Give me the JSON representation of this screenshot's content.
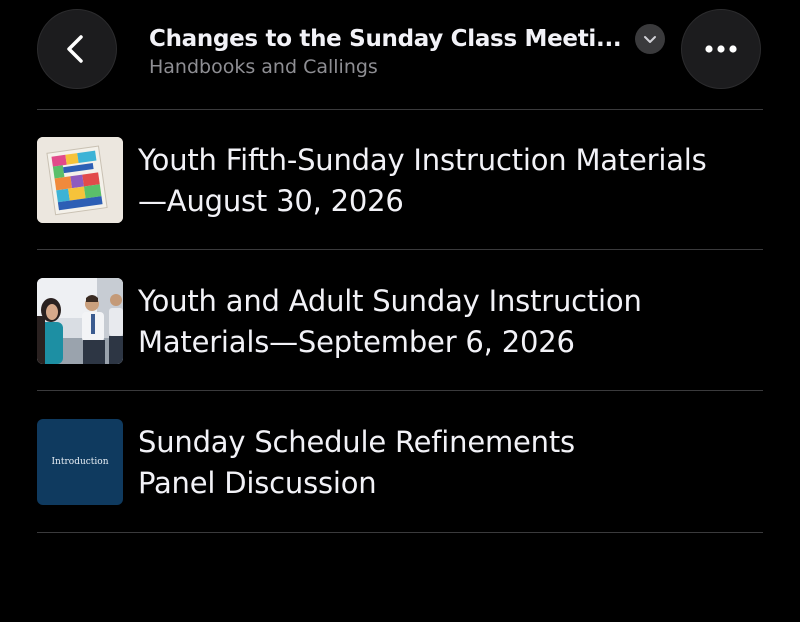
{
  "header": {
    "title": "Changes to the Sunday Class Meeti...",
    "subtitle": "Handbooks and Callings",
    "back_icon": "chevron-left-icon",
    "dropdown_icon": "chevron-down-icon",
    "more_icon": "ellipsis-icon"
  },
  "items": [
    {
      "title_line1": "Youth Fifth-Sunday Instruction Materials",
      "title_line2": "—August 30, 2026",
      "thumbnail": "booklet-cover-thumbnail"
    },
    {
      "title_line1": "Youth and Adult Sunday Instruction",
      "title_line2": "Materials—September 6, 2026",
      "thumbnail": "class-photo-thumbnail"
    },
    {
      "title_line1": "Sunday Schedule Refinements",
      "title_line2": "Panel Discussion",
      "thumbnail": "introduction-slide-thumbnail",
      "thumbnail_text": "Introduction"
    }
  ],
  "colors": {
    "background": "#000000",
    "button_bg": "#1c1c1e",
    "divider": "#3a3a3c",
    "subtitle": "#8e8e93",
    "slide_blue": "#0f3a5f"
  }
}
